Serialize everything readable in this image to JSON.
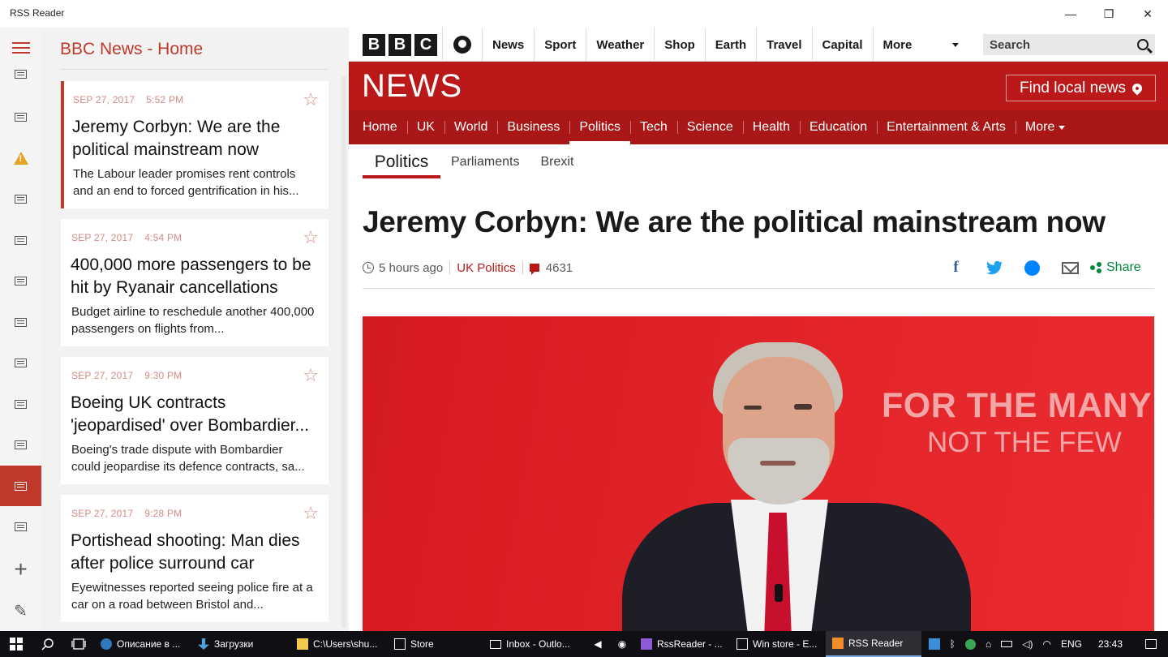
{
  "window": {
    "title": "RSS Reader",
    "minimize": "—",
    "maximize": "❐",
    "close": "✕"
  },
  "feed": {
    "title": "BBC News - Home",
    "articles": [
      {
        "date": "SEP 27, 2017",
        "time": "5:52 PM",
        "headline": "Jeremy Corbyn: We are the political mainstream now",
        "summary": "The Labour leader promises rent controls and an end to forced gentrification in his..."
      },
      {
        "date": "SEP 27, 2017",
        "time": "4:54 PM",
        "headline": "400,000 more passengers to be hit by Ryanair cancellations",
        "summary": "Budget airline to reschedule another 400,000 passengers on flights from..."
      },
      {
        "date": "SEP 27, 2017",
        "time": "9:30 PM",
        "headline": "Boeing UK contracts 'jeopardised' over Bombardier...",
        "summary": "Boeing's trade dispute with Bombardier could jeopardise its defence contracts, sa..."
      },
      {
        "date": "SEP 27, 2017",
        "time": "9:28 PM",
        "headline": "Portishead shooting: Man dies after police surround car",
        "summary": "Eyewitnesses reported seeing police fire at a car on a road between Bristol and..."
      }
    ],
    "star_glyph": "☆"
  },
  "bbc": {
    "logo": [
      "B",
      "B",
      "C"
    ],
    "top_nav": [
      "News",
      "Sport",
      "Weather",
      "Shop",
      "Earth",
      "Travel",
      "Capital"
    ],
    "top_nav_more": "More",
    "search_placeholder": "Search",
    "wordmark": "NEWS",
    "find_local": "Find local news",
    "section_nav": [
      "Home",
      "UK",
      "World",
      "Business",
      "Politics",
      "Tech",
      "Science",
      "Health",
      "Education",
      "Entertainment & Arts"
    ],
    "section_more": "More",
    "sub_nav": [
      "Politics",
      "Parliaments",
      "Brexit"
    ],
    "article": {
      "headline": "Jeremy Corbyn: We are the political mainstream now",
      "age": "5 hours ago",
      "topic": "UK Politics",
      "comments": "4631",
      "share": "Share",
      "facebook_glyph": "f"
    },
    "hero_slogan": {
      "line1": "FOR THE MANY",
      "line2": "NOT THE FEW"
    }
  },
  "taskbar": {
    "tasks": [
      {
        "label": "Описание в ...",
        "color": "#3277bc"
      },
      {
        "label": "Загрузки",
        "color": "#4aa3df"
      },
      {
        "label": "C:\\Users\\shu...",
        "color": "#f2c94c"
      },
      {
        "label": "Store",
        "color": "#ffffff"
      },
      {
        "label": "Inbox - Outlo...",
        "color": "#ffffff"
      },
      {
        "label": "RssReader - ...",
        "color": "#8e5bd6"
      },
      {
        "label": "Win store - E...",
        "color": "#ffffff"
      },
      {
        "label": "RSS Reader",
        "color": "#f28c28"
      }
    ],
    "tray": {
      "language": "ENG",
      "clock": "23:43"
    }
  },
  "colors": {
    "accent_red": "#c0392b",
    "bbc_red": "#bb1919",
    "share_green": "#008a3c"
  }
}
